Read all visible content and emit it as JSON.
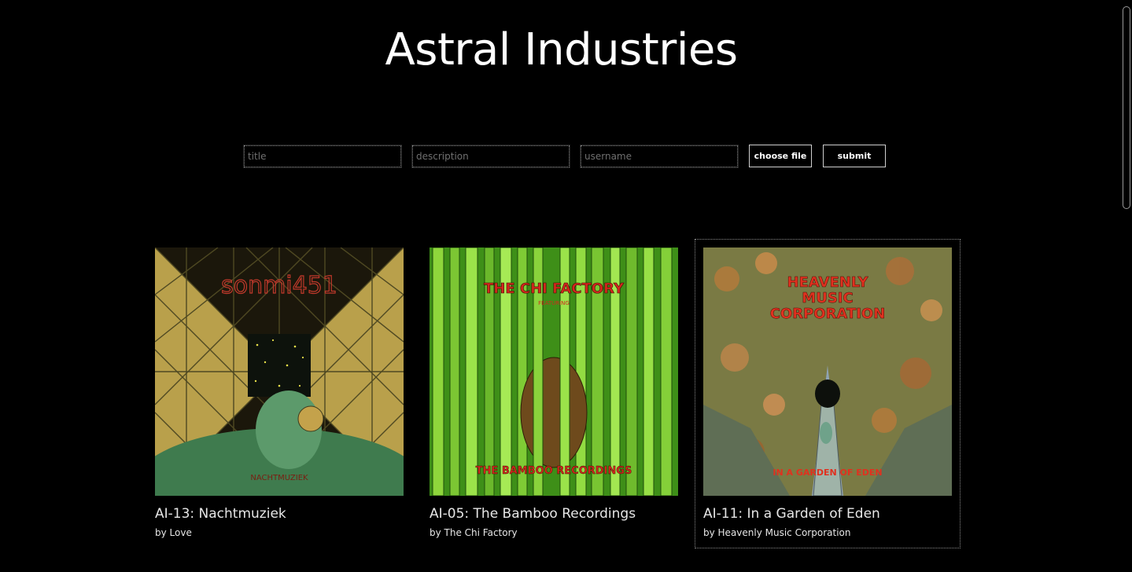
{
  "header": {
    "title": "Astral Industries"
  },
  "form": {
    "title_placeholder": "title",
    "description_placeholder": "description",
    "username_placeholder": "username",
    "choose_file_label": "choose file",
    "submit_label": "submit"
  },
  "releases": [
    {
      "title": "AI-13: Nachtmuziek",
      "by": "by Love",
      "cover_text": "sonmi451",
      "cover_subtext": "NACHTMUZIEK",
      "palette": {
        "bg": "#b9a04b",
        "accent": "#2f7a52",
        "text": "#c0392b"
      }
    },
    {
      "title": "AI-05: The Bamboo Recordings",
      "by": "by The Chi Factory",
      "cover_text": "THE CHI FACTORY",
      "cover_subtext": "THE BAMBOO RECORDINGS",
      "palette": {
        "bg": "#3e8f18",
        "accent": "#9be34a",
        "text": "#d2281c"
      }
    },
    {
      "title": "AI-11: In a Garden of Eden",
      "by": "by Heavenly Music Corporation",
      "cover_text": "HEAVENLY MUSIC CORPORATION",
      "cover_subtext": "IN A GARDEN OF EDEN",
      "palette": {
        "bg": "#7a7a44",
        "accent": "#9fb3a8",
        "text": "#e0311f"
      }
    }
  ]
}
